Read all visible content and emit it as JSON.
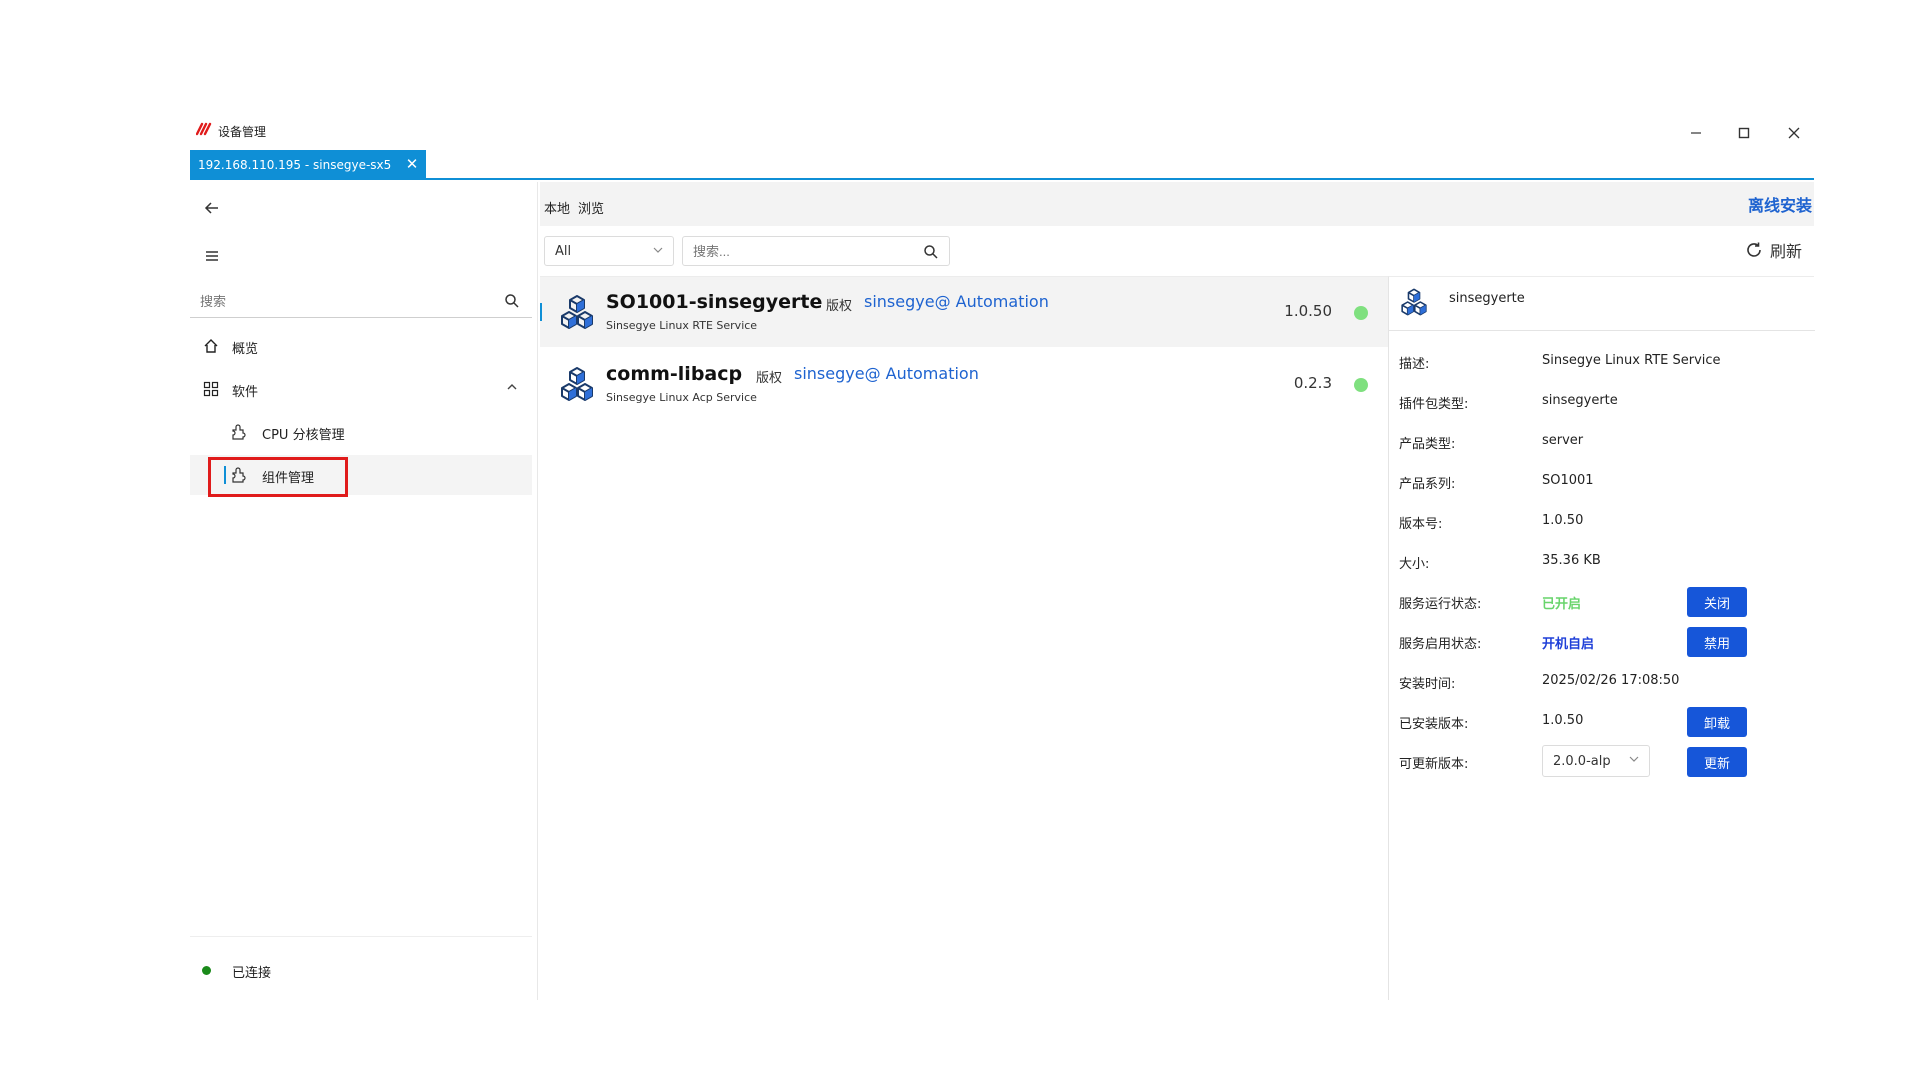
{
  "window": {
    "title": "设备管理",
    "tab_label": "192.168.110.195 - sinsegye-sx5"
  },
  "sidebar": {
    "search_placeholder": "搜索",
    "items": [
      {
        "label": "概览",
        "icon": "home-icon"
      },
      {
        "label": "软件",
        "icon": "grid-icon"
      },
      {
        "label": "CPU 分核管理",
        "icon": "plugin-icon"
      },
      {
        "label": "组件管理",
        "icon": "plugin-icon"
      }
    ],
    "status": "已连接"
  },
  "main": {
    "tabs": [
      {
        "label": "本地"
      },
      {
        "label": "浏览"
      }
    ],
    "offline_install": "离线安装",
    "filter_value": "All",
    "search_placeholder": "搜索...",
    "refresh_label": "刷新",
    "packages": [
      {
        "name": "SO1001-sinsegyerte",
        "copyright": "版权",
        "vendor": "sinsegye@ Automation",
        "description": "Sinsegye Linux RTE Service",
        "version": "1.0.50"
      },
      {
        "name": "comm-libacp",
        "copyright": "版权",
        "vendor": "sinsegye@ Automation",
        "description": "Sinsegye Linux Acp Service",
        "version": "0.2.3"
      }
    ]
  },
  "details": {
    "title": "sinsegyerte",
    "rows": {
      "description": {
        "label": "描述:",
        "value": "Sinsegye Linux RTE Service"
      },
      "plugin_type": {
        "label": "插件包类型:",
        "value": "sinsegyerte"
      },
      "product_type": {
        "label": "产品类型:",
        "value": "server"
      },
      "product_series": {
        "label": "产品系列:",
        "value": "SO1001"
      },
      "version": {
        "label": "版本号:",
        "value": "1.0.50"
      },
      "size": {
        "label": "大小:",
        "value": "35.36 KB"
      },
      "run_state": {
        "label": "服务运行状态:",
        "value": "已开启",
        "button": "关闭"
      },
      "enable_state": {
        "label": "服务启用状态:",
        "value": "开机自启",
        "button": "禁用"
      },
      "install_time": {
        "label": "安装时间:",
        "value": "2025/02/26 17:08:50"
      },
      "installed_version": {
        "label": "已安装版本:",
        "value": "1.0.50",
        "button": "卸载"
      },
      "update_version": {
        "label": "可更新版本:",
        "value": "2.0.0-alp",
        "button": "更新"
      }
    }
  },
  "colors": {
    "accent": "#0f8fd6",
    "primary_button": "#1656d9",
    "status_green": "#68d46b",
    "highlight": "#e01b1b"
  }
}
